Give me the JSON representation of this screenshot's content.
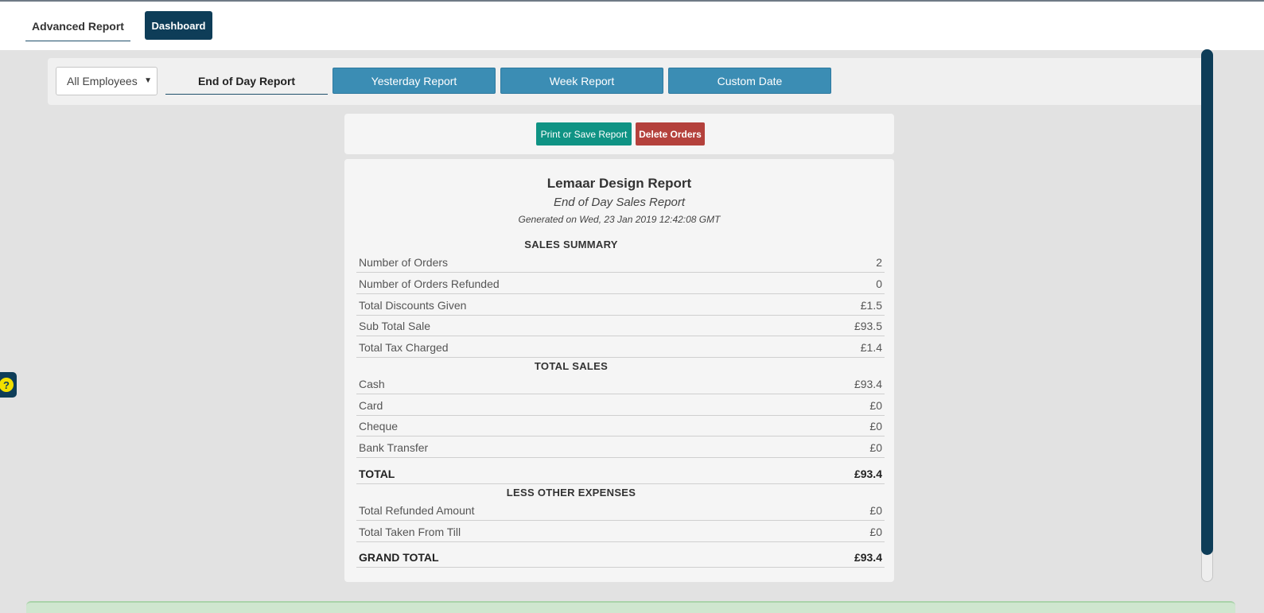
{
  "nav": {
    "advanced_report": "Advanced Report",
    "dashboard": "Dashboard"
  },
  "filters": {
    "employee_selected": "All Employees",
    "tabs": {
      "end_of_day": "End of Day Report",
      "yesterday": "Yesterday Report",
      "week": "Week Report",
      "custom": "Custom Date"
    }
  },
  "actions": {
    "print": "Print or Save Report",
    "delete": "Delete Orders"
  },
  "report": {
    "title": "Lemaar Design Report",
    "subtitle": "End of Day Sales Report",
    "generated": "Generated on Wed, 23 Jan 2019 12:42:08 GMT",
    "sales_summary": {
      "heading": "SALES SUMMARY",
      "rows": [
        {
          "label": "Number of Orders",
          "value": "2"
        },
        {
          "label": "Number of Orders Refunded",
          "value": "0"
        },
        {
          "label": "Total Discounts Given",
          "value": "£1.5"
        },
        {
          "label": "Sub Total Sale",
          "value": "£93.5"
        },
        {
          "label": "Total Tax Charged",
          "value": "£1.4"
        }
      ]
    },
    "total_sales": {
      "heading": "TOTAL SALES",
      "rows": [
        {
          "label": "Cash",
          "value": "£93.4"
        },
        {
          "label": "Card",
          "value": "£0"
        },
        {
          "label": "Cheque",
          "value": "£0"
        },
        {
          "label": "Bank Transfer",
          "value": "£0"
        }
      ],
      "total_label": "TOTAL",
      "total_value": "£93.4"
    },
    "expenses": {
      "heading": "LESS OTHER EXPENSES",
      "rows": [
        {
          "label": "Total Refunded Amount",
          "value": "£0"
        },
        {
          "label": "Total Taken From Till",
          "value": "£0"
        }
      ],
      "grand_total_label": "GRAND TOTAL",
      "grand_total_value": "£93.4"
    }
  },
  "help": {
    "glyph": "?"
  },
  "colors": {
    "primary": "#0e3d58",
    "tab_button": "#3b8db4",
    "print_button": "#0f9384",
    "delete_button": "#b4413c",
    "help_icon": "#f2e000"
  }
}
